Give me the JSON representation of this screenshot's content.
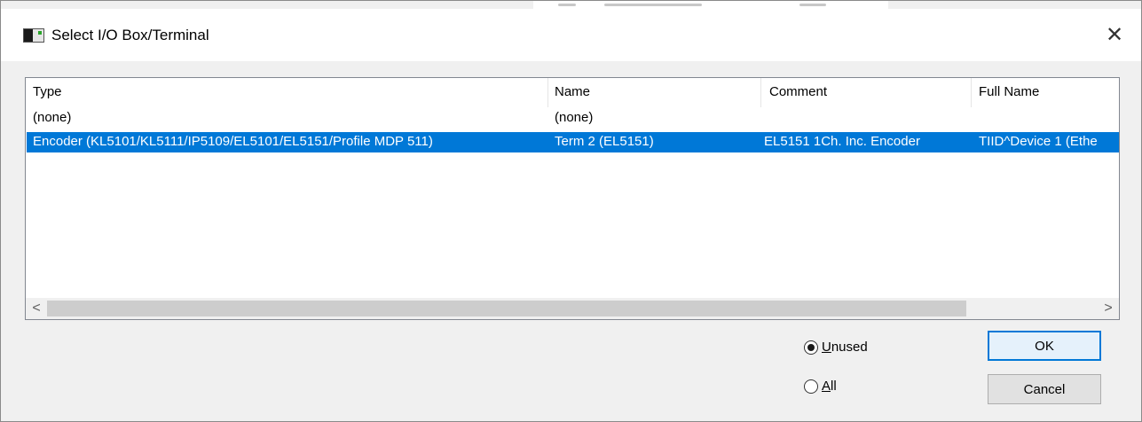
{
  "window": {
    "title": "Select I/O Box/Terminal",
    "close_glyph": "✕",
    "icon": "app-window-icon"
  },
  "list": {
    "columns": [
      "Type",
      "Name",
      "Comment",
      "Full Name"
    ],
    "rows": [
      {
        "type": "(none)",
        "name": "(none)",
        "comment": "",
        "full_name": "",
        "selected": false
      },
      {
        "type": "Encoder (KL5101/KL5111/IP5109/EL5101/EL5151/Profile MDP 511)",
        "name": "Term 2 (EL5151)",
        "comment": "EL5151 1Ch. Inc. Encoder",
        "full_name": "TIID^Device 1 (Ethe",
        "selected": true
      }
    ],
    "selection_color": "#0078d7"
  },
  "scrollbar": {
    "left_arrow": "<",
    "right_arrow": ">"
  },
  "filter": {
    "options": [
      {
        "label": "Unused",
        "mnemonic": "U",
        "rest": "nused",
        "checked": true
      },
      {
        "label": "All",
        "mnemonic": "A",
        "rest": "ll",
        "checked": false
      }
    ]
  },
  "buttons": {
    "ok": "OK",
    "cancel": "Cancel"
  }
}
